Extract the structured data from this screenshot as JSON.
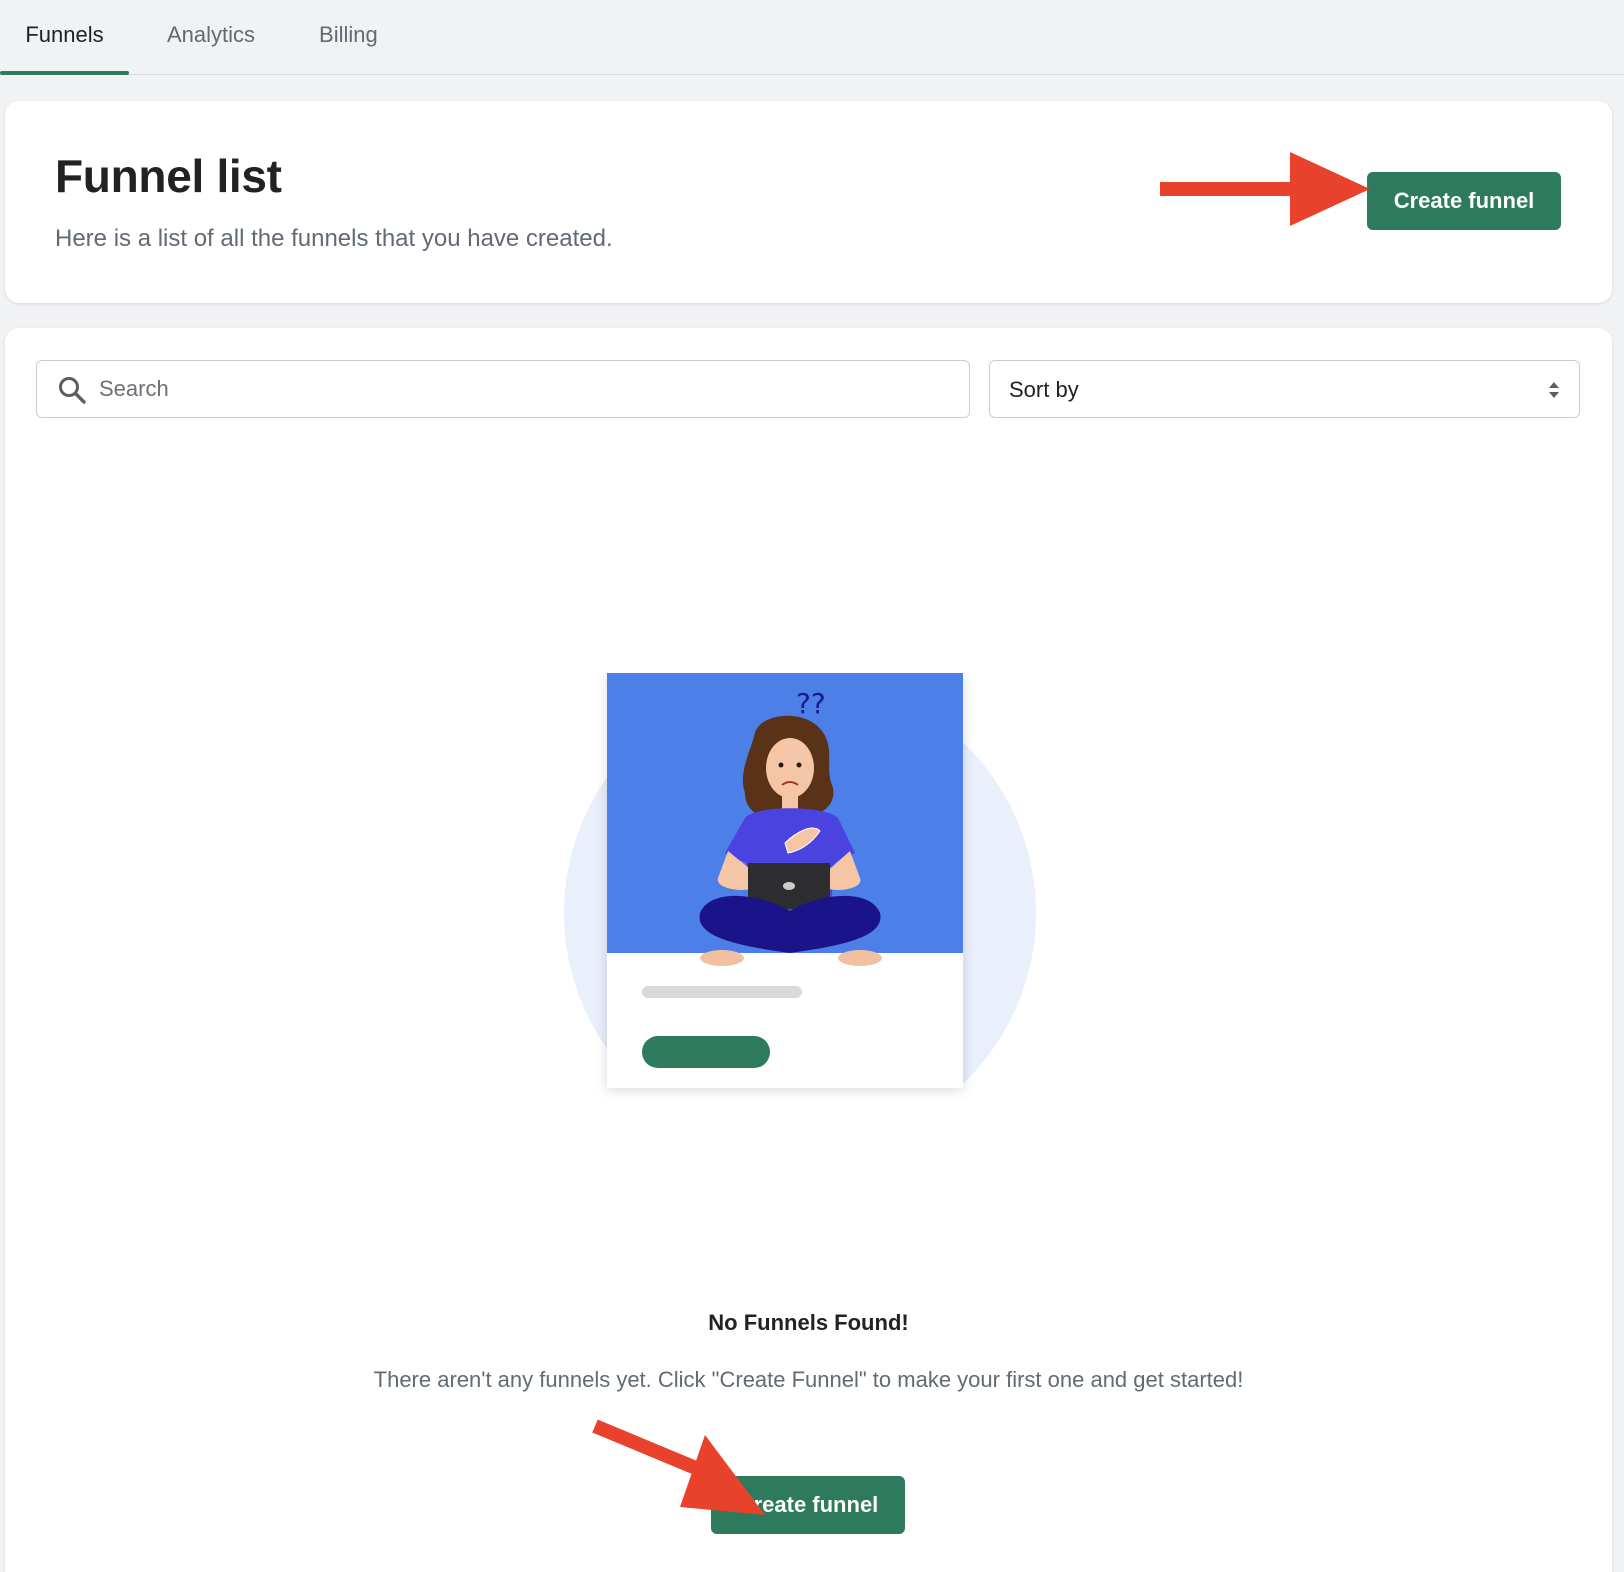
{
  "tabs": [
    {
      "label": "Funnels",
      "active": true
    },
    {
      "label": "Analytics",
      "active": false
    },
    {
      "label": "Billing",
      "active": false
    }
  ],
  "header": {
    "title": "Funnel list",
    "subtitle": "Here is a list of all the funnels that you have created.",
    "create_button": "Create funnel"
  },
  "filters": {
    "search_placeholder": "Search",
    "search_value": "",
    "sort_label": "Sort by"
  },
  "empty_state": {
    "title": "No Funnels Found!",
    "text": "There aren't any funnels yet. Click \"Create Funnel\" to make your first one and get started!",
    "create_button": "Create funnel",
    "illustration_icon": "confused-person-laptop-illustration"
  },
  "colors": {
    "accent": "#2e7a5c",
    "annotation_arrow": "#e8412c",
    "illustration_bg": "#4c7fe8"
  }
}
